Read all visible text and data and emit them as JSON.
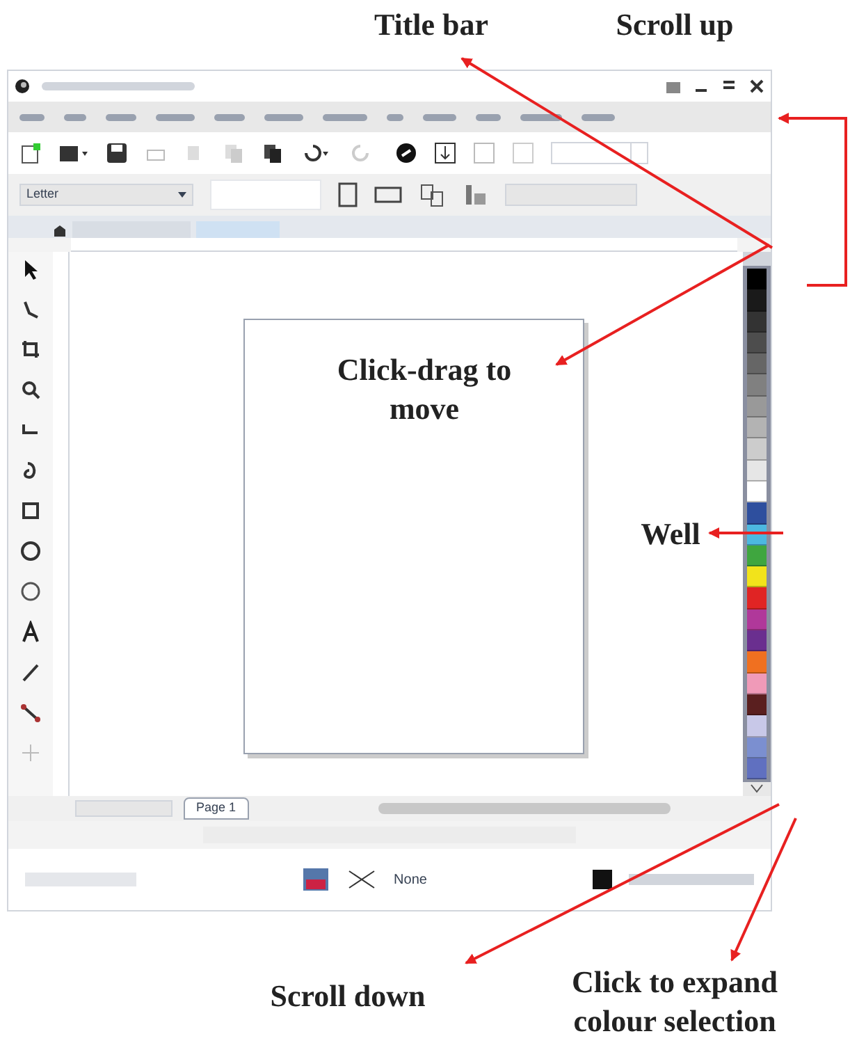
{
  "annotations": [
    {
      "text": "Title bar"
    },
    {
      "text": "Scroll up"
    },
    {
      "text": "Click-drag to move"
    },
    {
      "text": "Well"
    },
    {
      "text": "Scroll down"
    },
    {
      "text": "Click to expand colour selection"
    }
  ],
  "property_bar": {
    "page_size": "Letter"
  },
  "page_tabs": [
    {
      "label": "Page 1",
      "selected": true
    }
  ],
  "status_bar": {
    "outline": "None"
  },
  "palette": [
    {
      "color": "#000000"
    },
    {
      "color": "#1a1a1a"
    },
    {
      "color": "#333333"
    },
    {
      "color": "#4d4d4d"
    },
    {
      "color": "#666666"
    },
    {
      "color": "#808080"
    },
    {
      "color": "#999999"
    },
    {
      "color": "#b3b3b3"
    },
    {
      "color": "#cccccc"
    },
    {
      "color": "#e6e6e6"
    },
    {
      "color": "#ffffff"
    },
    {
      "color": "#2e4f9e"
    },
    {
      "color": "#4cb8e0"
    },
    {
      "color": "#3fa63f"
    },
    {
      "color": "#f2e31b"
    },
    {
      "color": "#e02424"
    },
    {
      "color": "#b0389a"
    },
    {
      "color": "#6a2f8f"
    },
    {
      "color": "#f07020"
    },
    {
      "color": "#f09ab8"
    },
    {
      "color": "#5a1f1f"
    },
    {
      "color": "#c8c8e8"
    },
    {
      "color": "#7b8fd0"
    },
    {
      "color": "#6070c0"
    }
  ]
}
